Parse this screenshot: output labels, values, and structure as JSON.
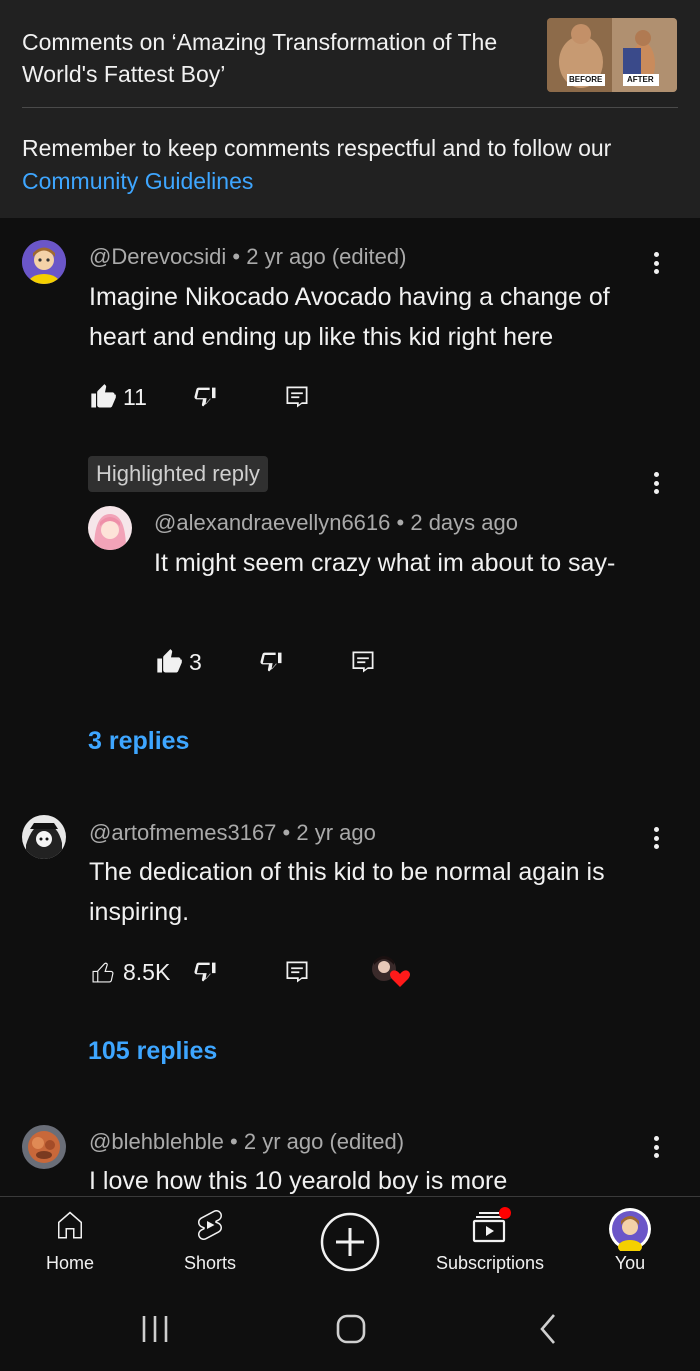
{
  "header": {
    "title": "Comments on ‘Amazing Transformation of The World's Fattest Boy’",
    "thumbnail": {
      "before_label": "BEFORE",
      "after_label": "AFTER"
    },
    "reminder_text": "Remember to keep comments respectful and to follow our",
    "guidelines_link": "Community Guidelines"
  },
  "comments": [
    {
      "author": "@Derevocsidi",
      "time": "2 yr ago (edited)",
      "text": "Imagine Nikocado Avocado having a change of heart and ending up like this kid right here",
      "likes": "11",
      "liked": true,
      "highlight_label": "Highlighted reply",
      "reply": {
        "author": "@alexandraevellyn6616",
        "time": "2 days ago",
        "text": "It might seem crazy what im about to say-",
        "likes": "3",
        "liked": true
      },
      "replies_label": "3 replies"
    },
    {
      "author": "@artofmemes3167",
      "time": "2 yr ago",
      "text": "The dedication of this kid to be normal again is inspiring.",
      "likes": "8.5K",
      "liked": false,
      "creator_heart": true,
      "replies_label": "105 replies"
    },
    {
      "author": "@blehblehble",
      "time": "2 yr ago (edited)",
      "text": "I love how this 10 yearold boy is more"
    }
  ],
  "nav": {
    "items": [
      {
        "label": "Home",
        "icon": "home-icon"
      },
      {
        "label": "Shorts",
        "icon": "shorts-icon"
      },
      {
        "label": "",
        "icon": "create-icon"
      },
      {
        "label": "Subscriptions",
        "icon": "subscriptions-icon"
      },
      {
        "label": "You",
        "icon": "avatar"
      }
    ]
  },
  "colors": {
    "accent_link": "#3ea6ff",
    "background": "#0f0f0f",
    "header_bg": "#212121",
    "notification_dot": "#ff0000"
  }
}
